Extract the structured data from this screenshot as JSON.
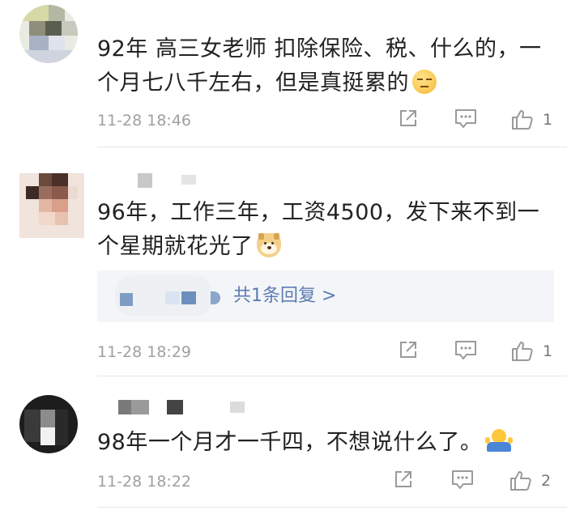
{
  "comments": [
    {
      "text": "92年 高三女老师 扣除保险、税、什么的，一个月七八千左右，但是真挺累的",
      "emoji": "smirk-face-emoji",
      "time": "11-28 18:46",
      "likes": "1"
    },
    {
      "text": "96年，工作三年，工资4500，发下来不到一个星期就花光了",
      "emoji": "doge-emoji",
      "time": "11-28 18:29",
      "likes": "1",
      "reply_link": "共1条回复 >"
    },
    {
      "text": "98年一个月才一千四，不想说什么了。",
      "emoji": "shrug-emoji",
      "time": "11-28 18:22",
      "likes": "2"
    }
  ],
  "icons": {
    "share": "share-icon",
    "reply": "reply-icon",
    "like": "thumbs-up-icon"
  },
  "colors": {
    "link": "#5b7cb1",
    "meta": "#a0a0a0",
    "icon": "#9a9a9a"
  }
}
